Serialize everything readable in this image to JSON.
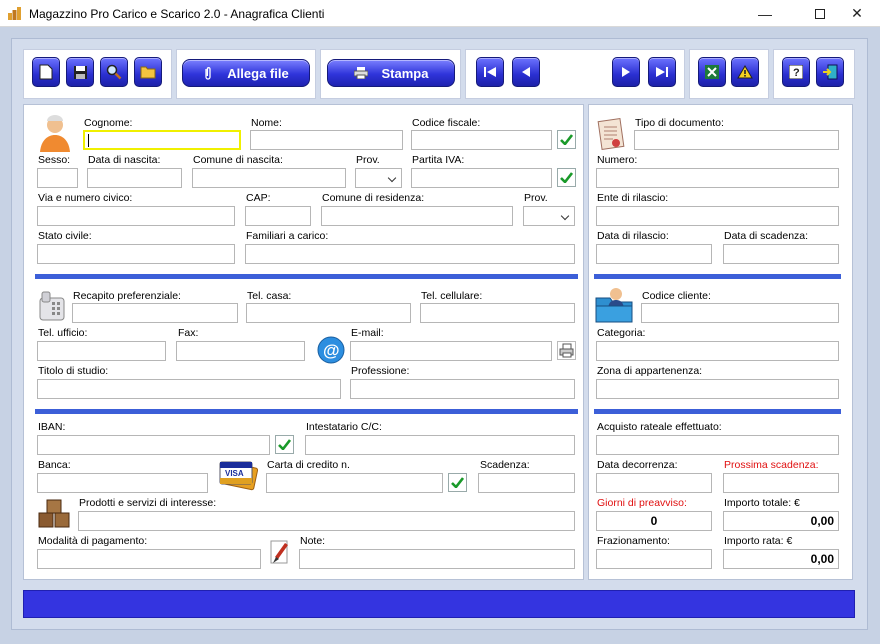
{
  "window": {
    "title": "Magazzino Pro Carico e Scarico 2.0 - Anagrafica Clienti"
  },
  "toolbar": {
    "attach_label": "Allega file",
    "print_label": "Stampa"
  },
  "personal": {
    "cognome": "Cognome:",
    "nome": "Nome:",
    "codice_fiscale": "Codice fiscale:",
    "sesso": "Sesso:",
    "data_nascita": "Data di nascita:",
    "comune_nascita": "Comune di nascita:",
    "prov": "Prov.",
    "partita_iva": "Partita IVA:",
    "via": "Via e numero civico:",
    "cap": "CAP:",
    "comune_residenza": "Comune di residenza:",
    "prov2": "Prov.",
    "stato_civile": "Stato civile:",
    "familiari": "Familiari a carico:"
  },
  "contacts": {
    "recapito": "Recapito preferenziale:",
    "tel_casa": "Tel. casa:",
    "tel_cell": "Tel. cellulare:",
    "tel_ufficio": "Tel. ufficio:",
    "fax": "Fax:",
    "email": "E-mail:",
    "titolo_studio": "Titolo di studio:",
    "professione": "Professione:"
  },
  "banking": {
    "iban": "IBAN:",
    "intestatario": "Intestatario C/C:",
    "banca": "Banca:",
    "carta": "Carta di credito n.",
    "scadenza": "Scadenza:",
    "prodotti": "Prodotti e servizi di interesse:",
    "pagamento": "Modalità di pagamento:",
    "note": "Note:"
  },
  "document": {
    "tipo": "Tipo di documento:",
    "numero": "Numero:",
    "ente": "Ente di rilascio:",
    "data_rilascio": "Data di rilascio:",
    "data_scadenza": "Data di scadenza:"
  },
  "client": {
    "codice": "Codice cliente:",
    "categoria": "Categoria:",
    "zona": "Zona di appartenenza:"
  },
  "installment": {
    "acquisto": "Acquisto rateale effettuato:",
    "decorrenza": "Data decorrenza:",
    "prossima": "Prossima scadenza:",
    "preavviso": "Giorni di preavviso:",
    "importo_totale": "Importo totale: €",
    "frazionamento": "Frazionamento:",
    "importo_rata": "Importo rata: €",
    "preavviso_value": "0",
    "totale_value": "0,00",
    "rata_value": "0,00"
  },
  "colors": {
    "accent": "#3c5fd8",
    "button": "#2f34da",
    "focus": "#f0f000",
    "warning_red": "#e01010"
  }
}
